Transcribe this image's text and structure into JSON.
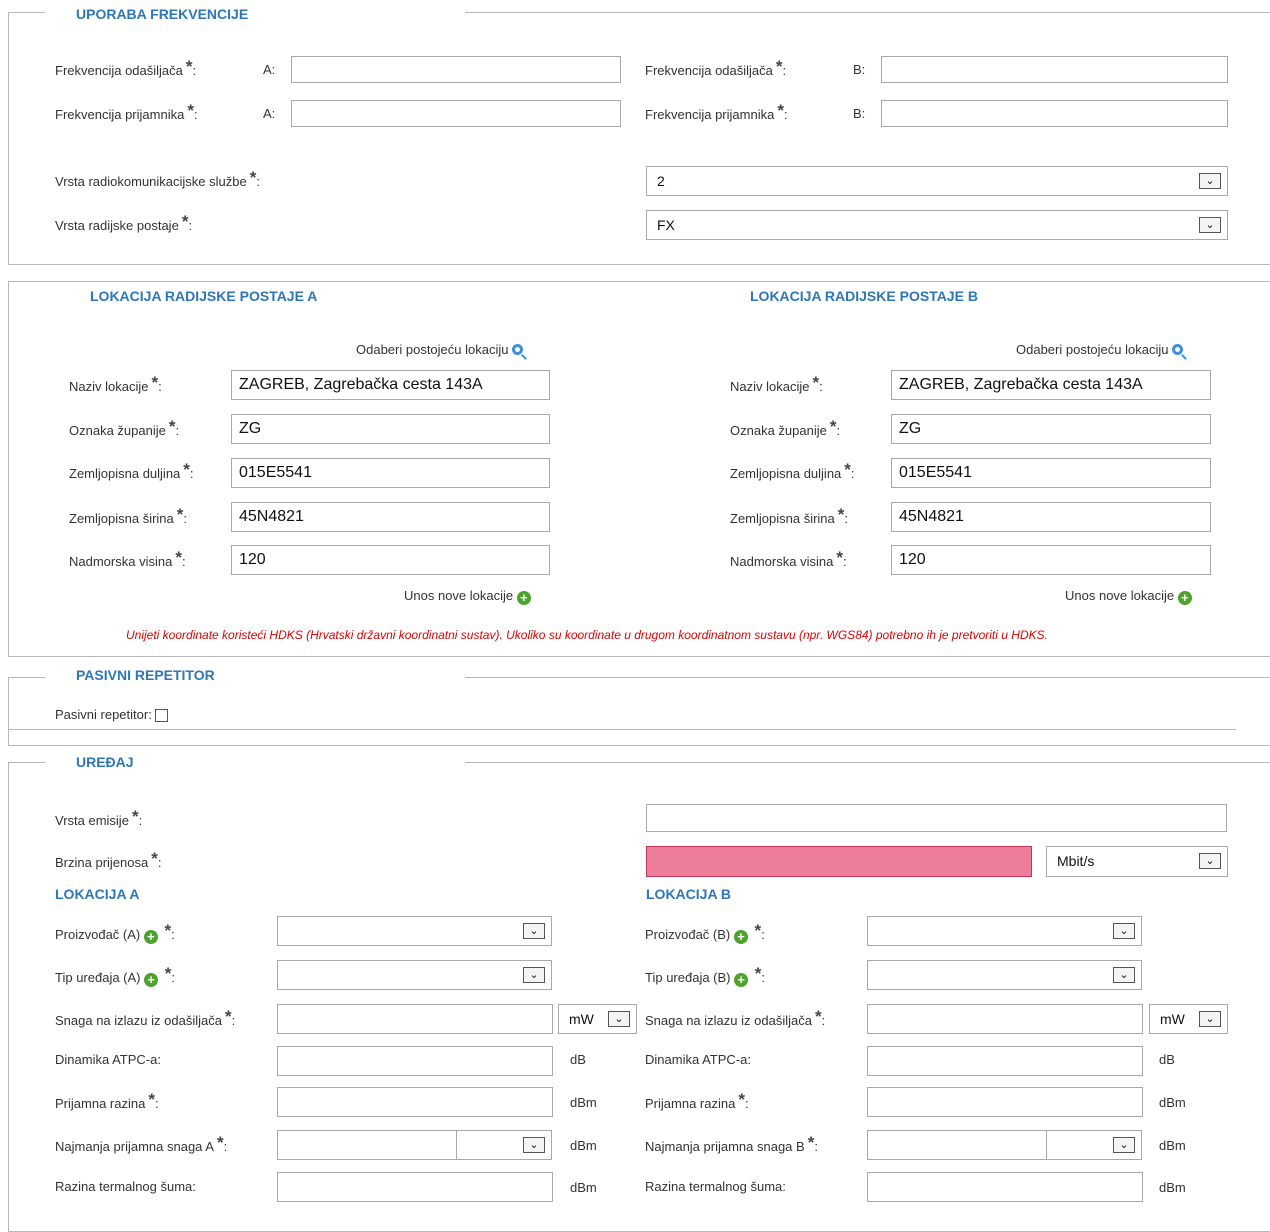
{
  "frequency": {
    "title": "UPORABA FREKVENCIJE",
    "tx_label": "Frekvencija odašiljača",
    "rx_label": "Frekvencija prijamnika",
    "side_a": "A:",
    "side_b": "B:",
    "tx_a": "",
    "tx_b": "",
    "rx_a": "",
    "rx_b": "",
    "service_label": "Vrsta radiokomunikacijske službe",
    "service_value": "2",
    "station_label": "Vrsta radijske postaje",
    "station_value": "FX"
  },
  "location": {
    "title_a": "LOKACIJA RADIJSKE POSTAJE A",
    "title_b": "LOKACIJA RADIJSKE POSTAJE B",
    "choose_existing": "Odaberi postojeću lokaciju",
    "new_location": "Unos nove lokacije",
    "labels": {
      "name": "Naziv lokacije",
      "county": "Oznaka županije",
      "longitude": "Zemljopisna duljina",
      "latitude": "Zemljopisna širina",
      "altitude": "Nadmorska visina"
    },
    "a": {
      "name": "ZAGREB, Zagrebačka cesta 143A",
      "county": "ZG",
      "longitude": "015E5541",
      "latitude": "45N4821",
      "altitude": "120"
    },
    "b": {
      "name": "ZAGREB, Zagrebačka cesta 143A",
      "county": "ZG",
      "longitude": "015E5541",
      "latitude": "45N4821",
      "altitude": "120"
    },
    "warning": "Unijeti koordinate koristeći HDKS (Hrvatski državni koordinatni sustav). Ukoliko su koordinate u drugom koordinatnom sustavu (npr. WGS84) potrebno ih je pretvoriti u HDKS."
  },
  "passive": {
    "title": "PASIVNI REPETITOR",
    "label": "Pasivni repetitor:",
    "checked": false
  },
  "device": {
    "title": "UREĐAJ",
    "emission_label": "Vrsta emisije",
    "emission_value": "",
    "rate_label": "Brzina prijenosa",
    "rate_value": "",
    "rate_unit": "Mbit/s",
    "loc_a_title": "LOKACIJA A",
    "loc_b_title": "LOKACIJA B",
    "manufacturer_a": "Proizvođač (A)",
    "manufacturer_b": "Proizvođač (B)",
    "type_a": "Tip uređaja (A)",
    "type_b": "Tip uređaja (B)",
    "power_label": "Snaga na izlazu iz odašiljača",
    "power_unit": "mW",
    "atpc_label": "Dinamika ATPC-a:",
    "rx_level_label": "Prijamna razina",
    "min_rx_a": "Najmanja prijamna snaga A",
    "min_rx_b": "Najmanja prijamna snaga B",
    "noise_label": "Razina termalnog šuma:",
    "unit_db": "dB",
    "unit_dbm": "dBm"
  },
  "colors": {
    "accent": "#2d77b8",
    "error_fill": "#ee7d99",
    "warning_text": "#e20000"
  }
}
